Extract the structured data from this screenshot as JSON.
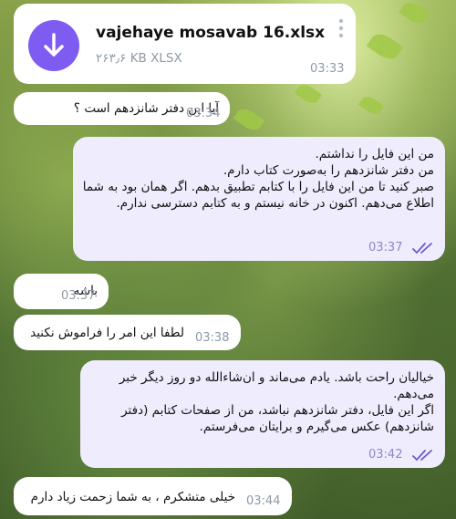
{
  "file_message": {
    "filename": "vajehaye mosavab 16.xlsx",
    "meta": "۲۶۳٫۶ KB XLSX",
    "time": "03:33",
    "icon": "download-icon",
    "accent_color": "#7e5cf1"
  },
  "messages": [
    {
      "direction": "in",
      "text": "آیا این دفتر شانزدهم است ؟",
      "time": "03:34"
    },
    {
      "direction": "out",
      "text": "من این فایل را نداشتم.\nمن دفتر شانزدهم را به‌صورت کتاب دارم.\nصبر کنید تا من این فایل را با کتابم تطبیق بدهم. اگر همان بود به شما اطلاع می‌دهم. اکنون در خانه نیستم و به کتابم دسترسی ندارم.",
      "time": "03:37",
      "read": true
    },
    {
      "direction": "in",
      "text": "باشه",
      "time": "03:37"
    },
    {
      "direction": "in",
      "text": "لطفا این امر را فراموش نکنید",
      "time": "03:38"
    },
    {
      "direction": "out",
      "text": "خیالیان راحت باشد. یادم می‌ماند و ان‌شاءالله دو روز دیگر خبر می‌دهم.\nاگر این فایل، دفتر شانزدهم نباشد، من از صفحات کتابم (دفتر شانزدهم) عکس می‌گیرم و برایتان می‌فرستم.",
      "time": "03:42",
      "read": true
    },
    {
      "direction": "in",
      "text": "خیلی متشکرم ، به شما زحمت زیاد دارم",
      "time": "03:44"
    }
  ]
}
